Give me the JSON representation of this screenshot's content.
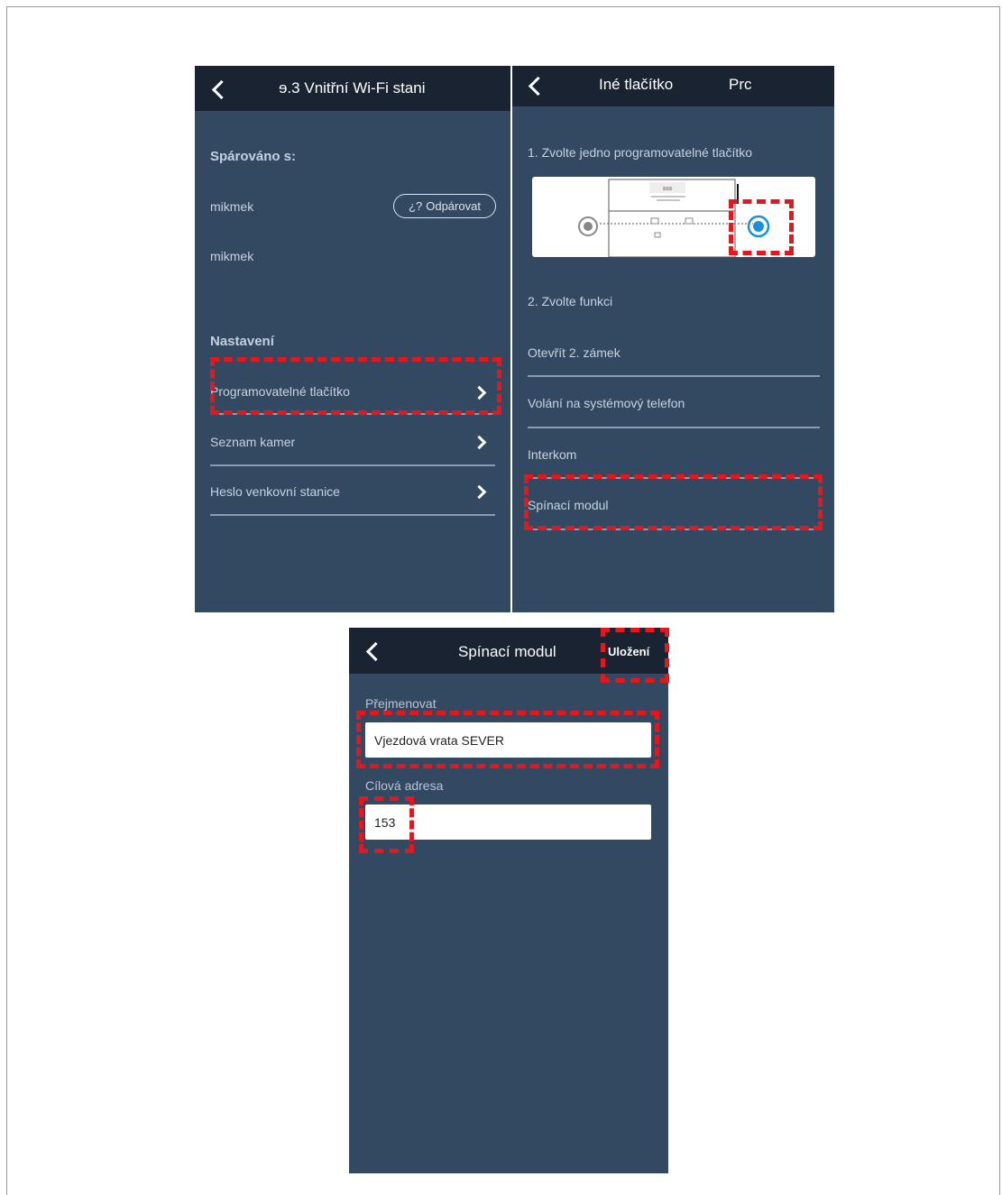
{
  "screen1": {
    "title": "ɘ.3 Vnitřní Wi-Fi stani",
    "paired_heading": "Spárováno s:",
    "paired_devices": [
      "mikmek",
      "mikmek"
    ],
    "unpair_label": "Odpárovat",
    "settings_heading": "Nastavení",
    "settings_items": [
      "Programovatelné tlačítko",
      "Seznam kamer",
      "Heslo venkovní stanice"
    ]
  },
  "screen2": {
    "title": "Iné tlačítko",
    "title_extra": "Prc",
    "step1": "1. Zvolte jedno programovatelné tlačítko",
    "step2": "2. Zvolte funkci",
    "functions": [
      "Otevřít 2. zámek",
      "Volání na systémový telefon",
      "Interkom",
      "Spínací modul"
    ]
  },
  "screen3": {
    "title": "Spínací modul",
    "save_label": "Uložení",
    "rename_label": "Přejmenovat",
    "rename_value": "Vjezdová vrata SEVER",
    "address_label": "Cílová adresa",
    "address_value": "153"
  },
  "colors": {
    "screen_bg": "#334861",
    "title_bar": "#1a2332",
    "highlight": "#e3181e",
    "radio_selected": "#1a8fe0"
  },
  "icons": [
    "back-chevron-icon",
    "unlink-icon",
    "chevron-right-icon",
    "radio-icon"
  ]
}
